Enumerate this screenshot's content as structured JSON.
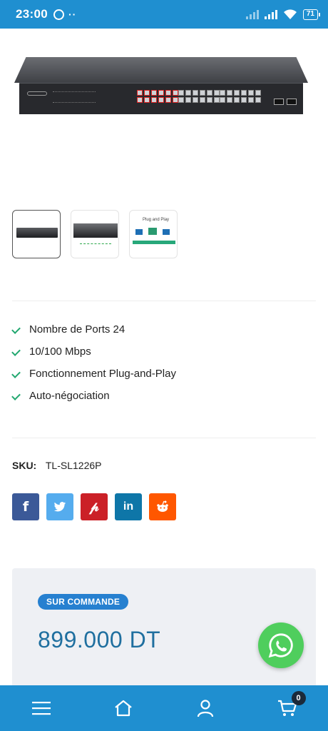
{
  "status_bar": {
    "time": "23:00",
    "battery": "71"
  },
  "product": {
    "features": [
      "Nombre de Ports 24",
      "10/100 Mbps",
      "Fonctionnement Plug-and-Play",
      "Auto-négociation"
    ],
    "sku_label": "SKU:",
    "sku_value": "TL-SL1226P",
    "availability": "SUR COMMANDE",
    "price": "899.000 DT",
    "thumbnails": [
      "switch-front-view",
      "switch-angle-view",
      "plug-and-play-diagram"
    ],
    "thumbnail_diagram_title": "Plug and Play"
  },
  "share": [
    {
      "network": "facebook",
      "icon": "f",
      "color": "#3b5998"
    },
    {
      "network": "twitter",
      "icon": "twitter-bird-icon",
      "color": "#55acee"
    },
    {
      "network": "pinterest",
      "icon": "P",
      "color": "#cb2027"
    },
    {
      "network": "linkedin",
      "icon": "in",
      "color": "#0e76a8"
    },
    {
      "network": "reddit",
      "icon": "reddit-icon",
      "color": "#ff5700"
    }
  ],
  "bottom_nav": {
    "items": [
      "menu",
      "home",
      "account",
      "cart"
    ],
    "cart_count": "0"
  },
  "colors": {
    "brand": "#1f8fd0",
    "price": "#1f6f9f",
    "check": "#22a870",
    "whatsapp": "#4fce5d",
    "badge": "#2680d0"
  }
}
